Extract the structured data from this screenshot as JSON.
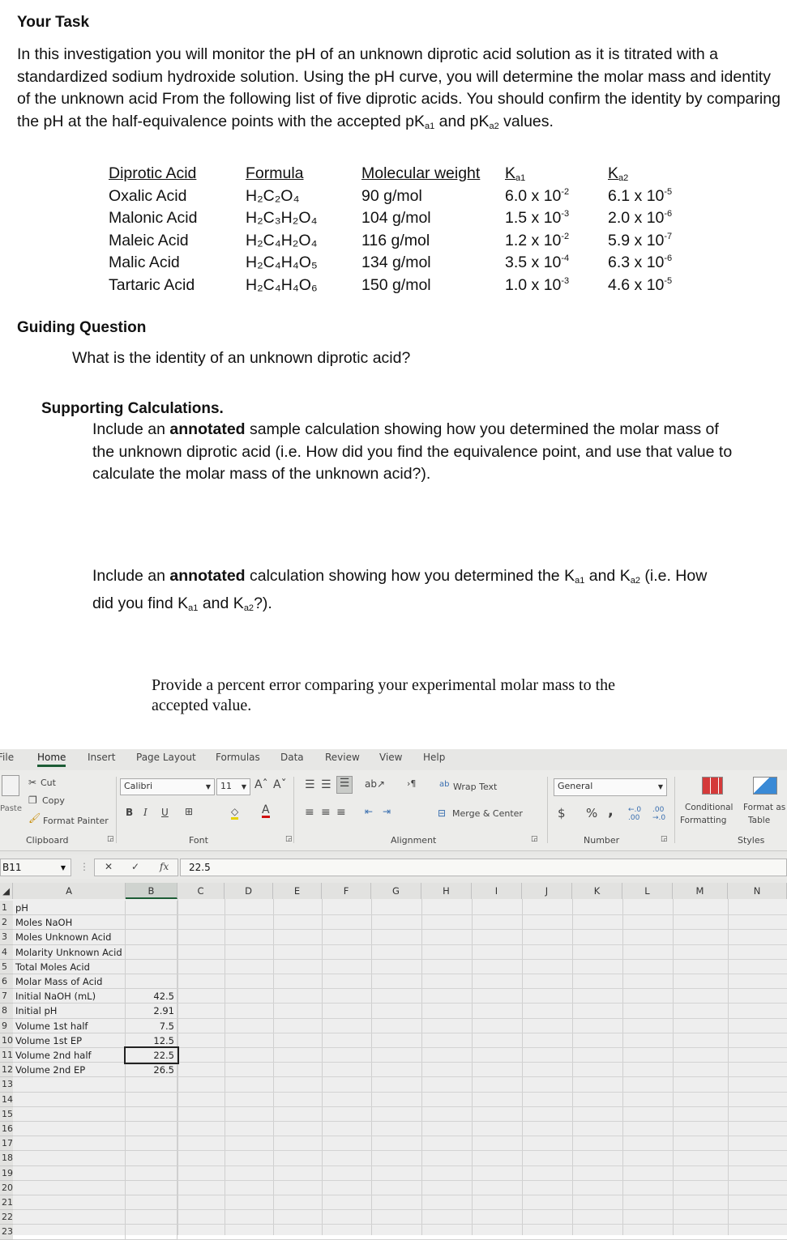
{
  "document": {
    "task_heading": "Your Task",
    "task_text": "In this investigation you will monitor the pH of an unknown diprotic acid solution as it is titrated with a standardized sodium hydroxide solution.  Using the pH curve, you will determine the molar mass and identity of the unknown acid From the following list of five diprotic acids.  You should confirm the identity by comparing the pH at the half-equivalence points with the accepted pK",
    "task_text_mid": " and pK",
    "task_text_end": " values.",
    "sub_a1": "a1",
    "sub_a2": "a2",
    "acid_table": {
      "headers": [
        "Diprotic Acid",
        "Formula",
        "Molecular weight",
        "Ka1",
        "Ka2"
      ],
      "rows": [
        {
          "name": "Oxalic Acid",
          "formula": "H₂C₂O₄",
          "mw": "90 g/mol",
          "ka1_base": "6.0 x 10",
          "ka1_exp": "-2",
          "ka2_base": "6.1 x 10",
          "ka2_exp": "-5"
        },
        {
          "name": "Malonic Acid",
          "formula": "H₂C₃H₂O₄",
          "mw": "104 g/mol",
          "ka1_base": "1.5 x 10",
          "ka1_exp": "-3",
          "ka2_base": "2.0 x 10",
          "ka2_exp": "-6"
        },
        {
          "name": "Maleic Acid",
          "formula": "H₂C₄H₂O₄",
          "mw": "116 g/mol",
          "ka1_base": "1.2 x 10",
          "ka1_exp": "-2",
          "ka2_base": "5.9 x 10",
          "ka2_exp": "-7"
        },
        {
          "name": "Malic Acid",
          "formula": "H₂C₄H₄O₅",
          "mw": "134 g/mol",
          "ka1_base": "3.5 x 10",
          "ka1_exp": "-4",
          "ka2_base": "6.3 x 10",
          "ka2_exp": "-6"
        },
        {
          "name": "Tartaric Acid",
          "formula": "H₂C₄H₄O₆",
          "mw": "150 g/mol",
          "ka1_base": "1.0 x 10",
          "ka1_exp": "-3",
          "ka2_base": "4.6 x 10",
          "ka2_exp": "-5"
        }
      ]
    },
    "guiding_heading": "Guiding Question",
    "guiding_text": "What is the identity of an unknown diprotic acid?",
    "supporting_heading": "Supporting Calculations.",
    "calc1_pre": "Include an ",
    "calc1_bold": "annotated",
    "calc1_post": " sample calculation showing how you determined the molar mass of the unknown diprotic acid (i.e. How did you find the equivalence point, and use that value to calculate the molar mass of the unknown acid?).",
    "calc2_pre": "Include an ",
    "calc2_bold": "annotated",
    "calc2_a": " calculation showing how you determined the K",
    "calc2_b": " and K",
    "calc2_c": " (i.e. How did you find K",
    "calc2_d": " and K",
    "calc2_e": "?).",
    "percent_error": "Provide a percent error comparing your experimental molar mass to the accepted value."
  },
  "excel": {
    "tabs": [
      "File",
      "Home",
      "Insert",
      "Page Layout",
      "Formulas",
      "Data",
      "Review",
      "View",
      "Help"
    ],
    "active_tab": "Home",
    "clipboard": {
      "paste": "Paste",
      "cut": "Cut",
      "copy": "Copy",
      "format_painter": "Format Painter",
      "label": "Clipboard"
    },
    "font": {
      "name": "Calibri",
      "size": "11",
      "bold": "B",
      "italic": "I",
      "underline": "U",
      "label": "Font"
    },
    "alignment": {
      "wrap_text": "Wrap Text",
      "merge_center": "Merge & Center",
      "label": "Alignment"
    },
    "number": {
      "format": "General",
      "currency": "$",
      "percent": "%",
      "comma": ",",
      "label": "Number"
    },
    "styles": {
      "conditional": "Conditional",
      "conditional2": "Formatting",
      "format_as": "Format as",
      "format_as2": "Table",
      "label": "Styles"
    },
    "name_box": "B11",
    "formula_value": "22.5",
    "columns": [
      "A",
      "B",
      "C",
      "D",
      "E",
      "F",
      "G",
      "H",
      "I",
      "J",
      "K",
      "L",
      "M",
      "N"
    ],
    "rows": [
      {
        "n": "1",
        "a": "pH",
        "b": ""
      },
      {
        "n": "2",
        "a": "Moles NaOH",
        "b": ""
      },
      {
        "n": "3",
        "a": "Moles Unknown Acid",
        "b": ""
      },
      {
        "n": "4",
        "a": "Molarity Unknown Acid",
        "b": ""
      },
      {
        "n": "5",
        "a": "Total Moles Acid",
        "b": ""
      },
      {
        "n": "6",
        "a": "Molar Mass of Acid",
        "b": ""
      },
      {
        "n": "7",
        "a": "Initial NaOH (mL)",
        "b": "42.5"
      },
      {
        "n": "8",
        "a": "Initial pH",
        "b": "2.91"
      },
      {
        "n": "9",
        "a": "Volume 1st half",
        "b": "7.5"
      },
      {
        "n": "10",
        "a": "Volume 1st EP",
        "b": "12.5"
      },
      {
        "n": "11",
        "a": "Volume 2nd half",
        "b": "22.5"
      },
      {
        "n": "12",
        "a": "Volume 2nd EP",
        "b": "26.5"
      },
      {
        "n": "13",
        "a": "",
        "b": ""
      },
      {
        "n": "14",
        "a": "",
        "b": ""
      },
      {
        "n": "15",
        "a": "",
        "b": ""
      },
      {
        "n": "16",
        "a": "",
        "b": ""
      },
      {
        "n": "17",
        "a": "",
        "b": ""
      },
      {
        "n": "18",
        "a": "",
        "b": ""
      },
      {
        "n": "19",
        "a": "",
        "b": ""
      },
      {
        "n": "20",
        "a": "",
        "b": ""
      },
      {
        "n": "21",
        "a": "",
        "b": ""
      },
      {
        "n": "22",
        "a": "",
        "b": ""
      },
      {
        "n": "23",
        "a": "",
        "b": ""
      }
    ],
    "active_cell_row": 11
  }
}
